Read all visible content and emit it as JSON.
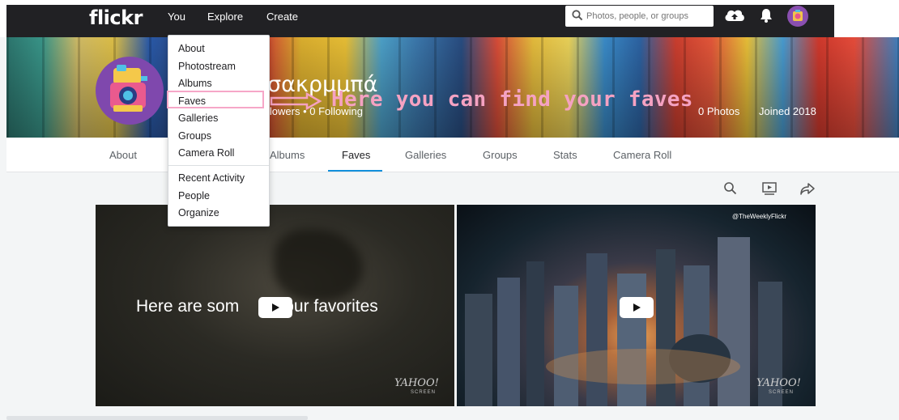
{
  "topbar": {
    "logo": "flickr",
    "nav": [
      "You",
      "Explore",
      "Create"
    ],
    "search_placeholder": "Photos, people, or groups"
  },
  "you_menu": {
    "items": [
      "About",
      "Photostream",
      "Albums",
      "Faves",
      "Galleries",
      "Groups",
      "Camera Roll"
    ],
    "items2": [
      "Recent Activity",
      "People",
      "Organize"
    ],
    "highlighted": "Faves"
  },
  "profile": {
    "username": "σακρμμπά",
    "followers": "llowers  •  0 Following",
    "photos": "0 Photos",
    "joined": "Joined 2018"
  },
  "annotation": {
    "text": "Here you can find your faves",
    "color": "#f5a2c2"
  },
  "tabs": {
    "items": [
      "About",
      "Albums",
      "Faves",
      "Galleries",
      "Groups",
      "Stats",
      "Camera Roll"
    ],
    "active": "Faves"
  },
  "photos": {
    "first_title": "Here are som",
    "first_title_end": "our favorites",
    "yahoo": "YAHOO!",
    "yahoo_sub": "SCREEN",
    "twitter_credit": "@TheWeeklyFlickr"
  },
  "colors": {
    "topbar": "#212124",
    "accent": "#128fdc",
    "background": "#f3f5f6"
  }
}
